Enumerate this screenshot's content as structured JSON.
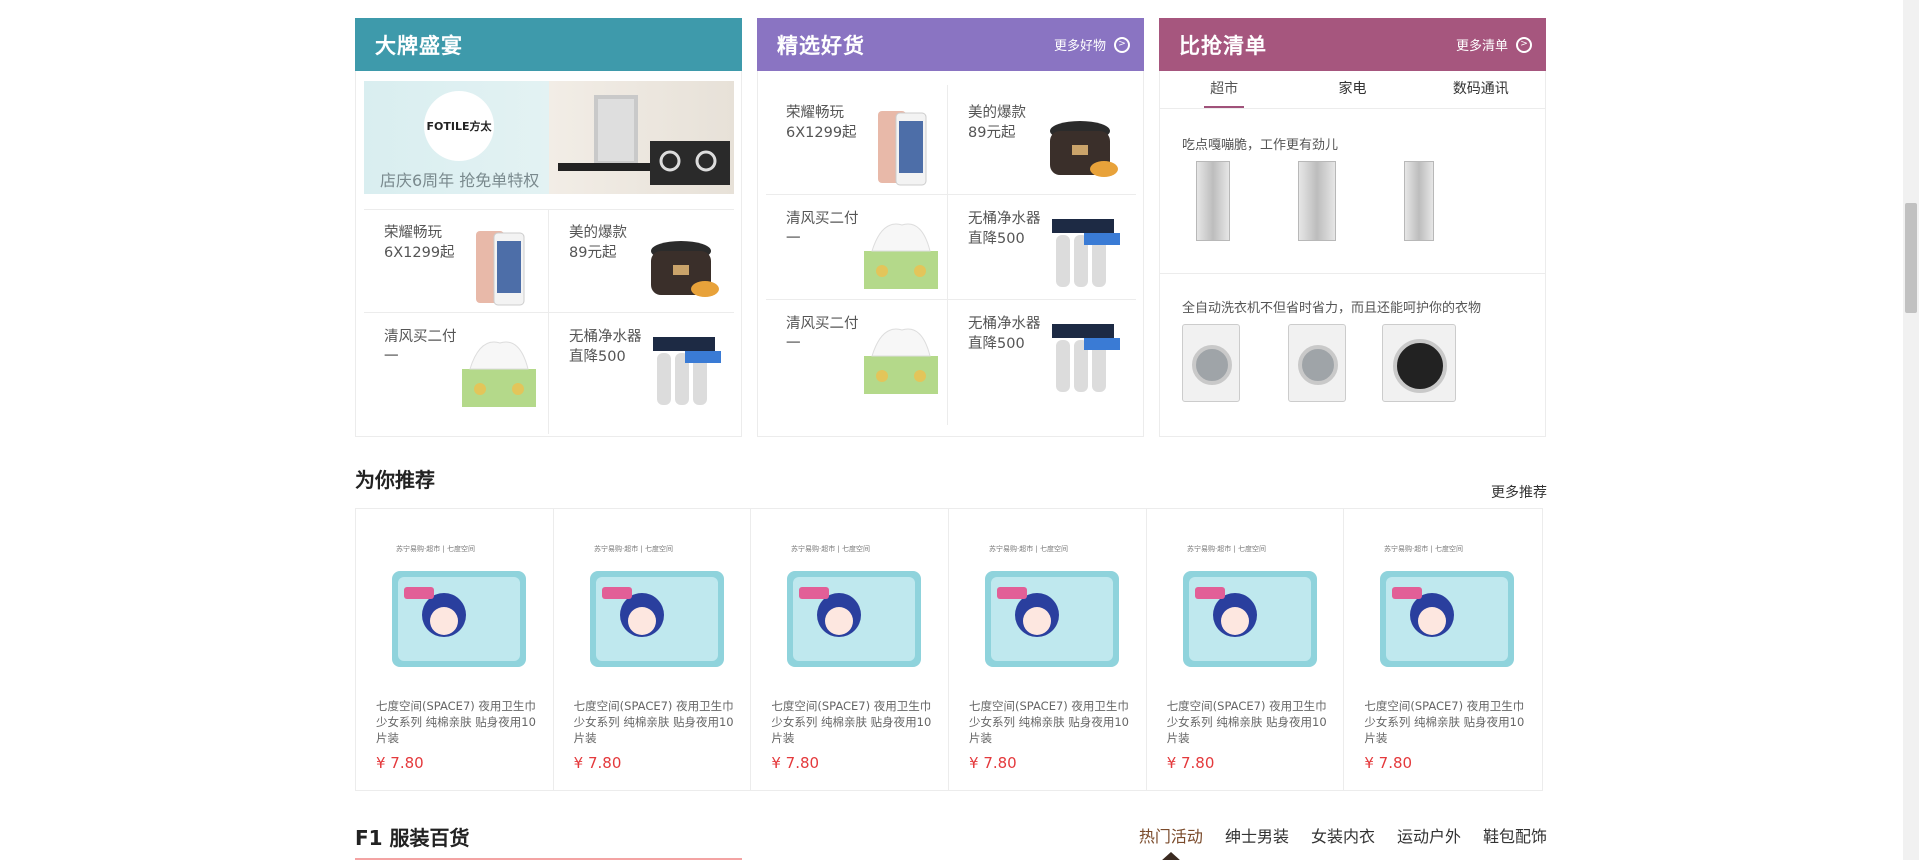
{
  "colors": {
    "panel1": "#3e9aab",
    "panel2": "#8a74c2",
    "panel3": "#a6567e",
    "price": "#e4393c"
  },
  "panels": [
    {
      "title": "大牌盛宴",
      "more": "",
      "banner": {
        "logo": "FOTILE方太",
        "text": "店庆6周年 抢免单特权"
      },
      "tiles": [
        {
          "name": "荣耀畅玩",
          "sub": "6X1299起",
          "icon": "phone-icon"
        },
        {
          "name": "美的爆款",
          "sub": "89元起",
          "icon": "rice-cooker-icon"
        },
        {
          "name": "清风买二付",
          "sub": "一",
          "icon": "tissue-icon"
        },
        {
          "name": "无桶净水器",
          "sub": "直降500",
          "icon": "water-purifier-icon"
        }
      ]
    },
    {
      "title": "精选好货",
      "more": "更多好物",
      "tiles": [
        {
          "name": "荣耀畅玩",
          "sub": "6X1299起",
          "icon": "phone-icon"
        },
        {
          "name": "美的爆款",
          "sub": "89元起",
          "icon": "rice-cooker-icon"
        },
        {
          "name": "清风买二付",
          "sub": "一",
          "icon": "tissue-icon"
        },
        {
          "name": "无桶净水器",
          "sub": "直降500",
          "icon": "water-purifier-icon"
        },
        {
          "name": "清风买二付",
          "sub": "一",
          "icon": "tissue-icon"
        },
        {
          "name": "无桶净水器",
          "sub": "直降500",
          "icon": "water-purifier-icon"
        }
      ]
    },
    {
      "title": "比抢清单",
      "more": "更多清单",
      "tabs": [
        "超市",
        "家电",
        "数码通讯"
      ],
      "active_tab": "超市",
      "sections": [
        {
          "text": "吃点嘎嘣脆，工作更有劲儿",
          "icon": "fridge-icon"
        },
        {
          "text": "全自动洗衣机不但省时省力，而且还能呵护你的衣物",
          "icon": "washer-icon"
        }
      ]
    }
  ],
  "recommend": {
    "title": "为你推荐",
    "more": "更多推荐",
    "products": [
      {
        "brand": "苏宁易购·超市 | 七度空间",
        "name": "七度空间(SPACE7) 夜用卫生巾 少女系列 纯棉亲肤 贴身夜用10片装",
        "price": "¥ 7.80"
      },
      {
        "brand": "苏宁易购·超市 | 七度空间",
        "name": "七度空间(SPACE7) 夜用卫生巾 少女系列 纯棉亲肤 贴身夜用10片装",
        "price": "¥ 7.80"
      },
      {
        "brand": "苏宁易购·超市 | 七度空间",
        "name": "七度空间(SPACE7) 夜用卫生巾 少女系列 纯棉亲肤 贴身夜用10片装",
        "price": "¥ 7.80"
      },
      {
        "brand": "苏宁易购·超市 | 七度空间",
        "name": "七度空间(SPACE7) 夜用卫生巾 少女系列 纯棉亲肤 贴身夜用10片装",
        "price": "¥ 7.80"
      },
      {
        "brand": "苏宁易购·超市 | 七度空间",
        "name": "七度空间(SPACE7) 夜用卫生巾 少女系列 纯棉亲肤 贴身夜用10片装",
        "price": "¥ 7.80"
      },
      {
        "brand": "苏宁易购·超市 | 七度空间",
        "name": "七度空间(SPACE7) 夜用卫生巾 少女系列 纯棉亲肤 贴身夜用10片装",
        "price": "¥ 7.80"
      }
    ]
  },
  "floor": {
    "title": "F1 服装百货",
    "tabs": [
      "热门活动",
      "绅士男装",
      "女装内衣",
      "运动户外",
      "鞋包配饰"
    ],
    "active_tab": "热门活动"
  }
}
